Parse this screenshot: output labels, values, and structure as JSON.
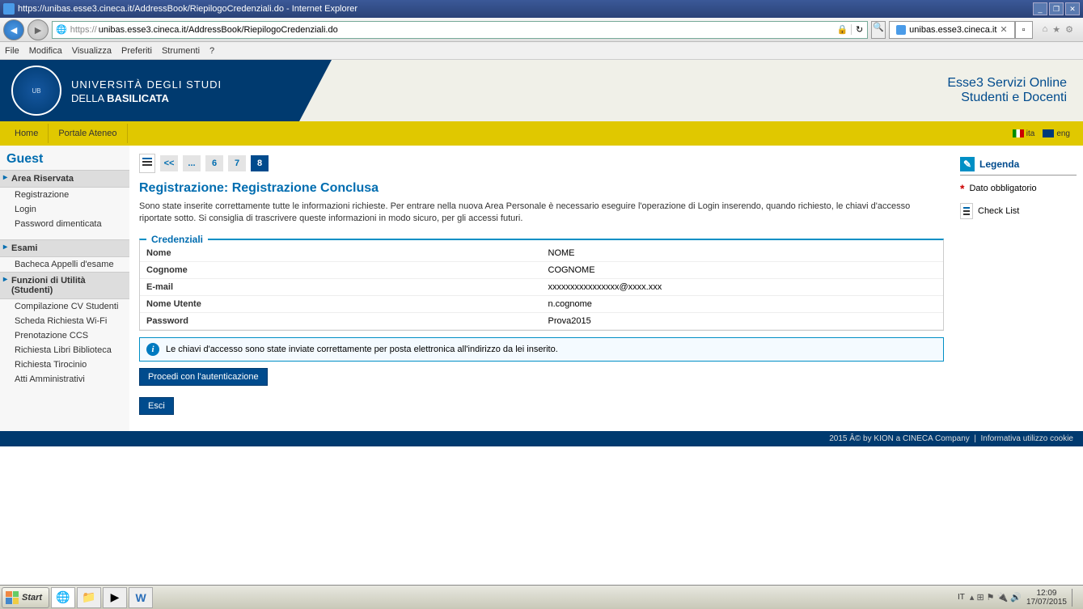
{
  "window": {
    "title": "https://unibas.esse3.cineca.it/AddressBook/RiepilogoCredenziali.do - Internet Explorer",
    "url_display": "unibas.esse3.cineca.it/AddressBook/RiepilogoCredenziali.do",
    "url_prefix": "https://",
    "tab_label": "unibas.esse3.cineca.it"
  },
  "ie_menu": [
    "File",
    "Modifica",
    "Visualizza",
    "Preferiti",
    "Strumenti",
    "?"
  ],
  "header": {
    "uni_line1_a": "UNIVERSITÀ",
    "uni_line1_b": "DEGLI STUDI",
    "uni_line2_a": "DELLA",
    "uni_line2_b": "BASILICATA",
    "service_l1": "Esse3 Servizi Online",
    "service_l2": "Studenti e Docenti"
  },
  "topnav": {
    "items": [
      "Home",
      "Portale Ateneo"
    ],
    "lang_ita": "ita",
    "lang_eng": "eng"
  },
  "sidebar": {
    "guest": "Guest",
    "g1": "Area Riservata",
    "g1_links": [
      "Registrazione",
      "Login",
      "Password dimenticata"
    ],
    "g2": "Esami",
    "g2_links": [
      "Bacheca Appelli d'esame"
    ],
    "g3": "Funzioni di Utilità (Studenti)",
    "g3_links": [
      "Compilazione CV Studenti",
      "Scheda Richiesta Wi-Fi",
      "Prenotazione CCS",
      "Richiesta Libri Biblioteca",
      "Richiesta Tirocinio",
      "Atti Amministrativi"
    ]
  },
  "wizard": {
    "steps": [
      "<<",
      "...",
      "6",
      "7",
      "8"
    ],
    "active": "8"
  },
  "page": {
    "title": "Registrazione: Registrazione Conclusa",
    "intro": "Sono state inserite correttamente tutte le informazioni richieste. Per entrare nella nuova Area Personale è necessario eseguire l'operazione di Login inserendo, quando richiesto, le chiavi d'accesso riportate sotto. Si consiglia di trascrivere queste informazioni in modo sicuro, per gli accessi futuri.",
    "fs_legend": "Credenziali",
    "rows": [
      {
        "label": "Nome",
        "value": "NOME"
      },
      {
        "label": "Cognome",
        "value": "COGNOME"
      },
      {
        "label": "E-mail",
        "value": "xxxxxxxxxxxxxxxx@xxxx.xxx"
      },
      {
        "label": "Nome Utente",
        "value": "n.cognome"
      },
      {
        "label": "Password",
        "value": "Prova2015"
      }
    ],
    "info_msg": "Le chiavi d'accesso sono state inviate correttamente per posta elettronica all'indirizzo da lei inserito.",
    "btn_proceed": "Procedi con l'autenticazione",
    "btn_exit": "Esci"
  },
  "legend": {
    "title": "Legenda",
    "mandatory": "Dato obbligatorio",
    "checklist": "Check List"
  },
  "footer": {
    "copyright": "2015 Â© by KION a CINECA Company",
    "cookie": "Informativa utilizzo cookie"
  },
  "taskbar": {
    "start": "Start",
    "lang": "IT",
    "time": "12:09",
    "date": "17/07/2015"
  }
}
